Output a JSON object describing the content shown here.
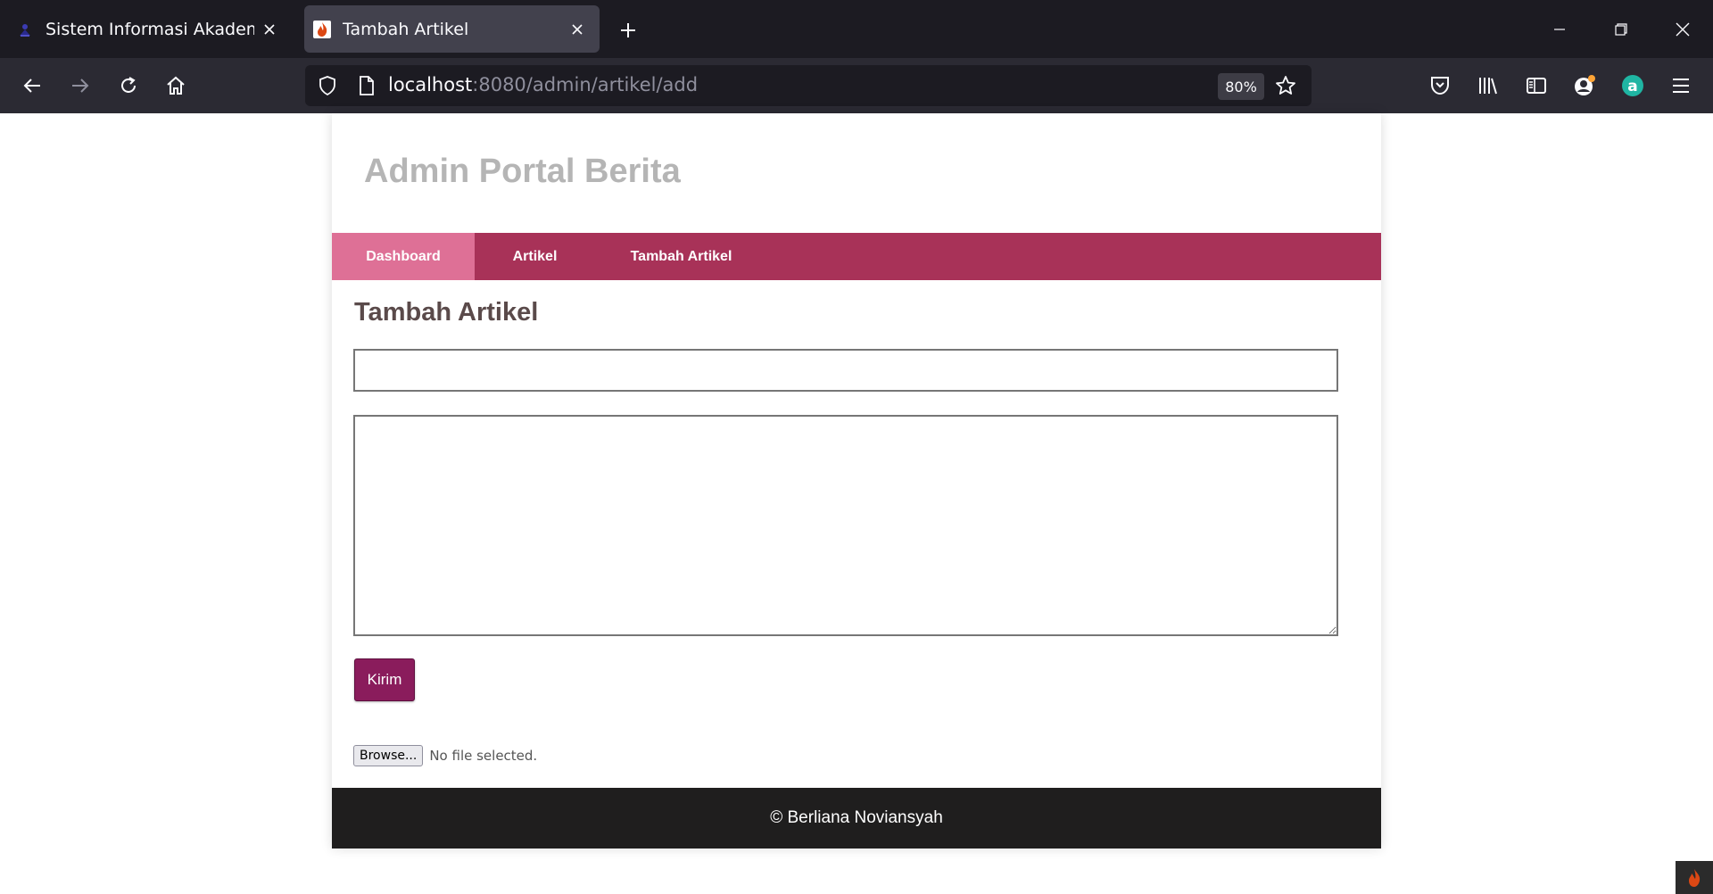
{
  "browser": {
    "tabs": [
      {
        "title": "Sistem Informasi Akademik",
        "active": false,
        "favicon": "academic-logo-icon"
      },
      {
        "title": "Tambah Artikel",
        "active": true,
        "favicon": "codeigniter-flame-icon"
      }
    ],
    "url": {
      "host": "localhost",
      "path": ":8080/admin/artikel/add"
    },
    "zoom": "80%",
    "colors": {
      "tabbar": "#1c1b22",
      "toolbar": "#2b2a33",
      "active_tab": "#42414d"
    }
  },
  "page": {
    "site_title": "Admin Portal Berita",
    "menu": [
      {
        "label": "Dashboard",
        "active": true
      },
      {
        "label": "Artikel",
        "active": false
      },
      {
        "label": "Tambah Artikel",
        "active": false
      }
    ],
    "heading": "Tambah Artikel",
    "form": {
      "title_value": "",
      "body_value": "",
      "submit_label": "Kirim",
      "file": {
        "button_label": "Browse...",
        "status": "No file selected."
      }
    },
    "footer": "© Berliana Noviansyah",
    "colors": {
      "menu": "#a83258",
      "menu_active": "#de7096",
      "submit": "#8a1c5c",
      "footer": "#1f1e1e",
      "title": "#b5b5b5"
    }
  }
}
